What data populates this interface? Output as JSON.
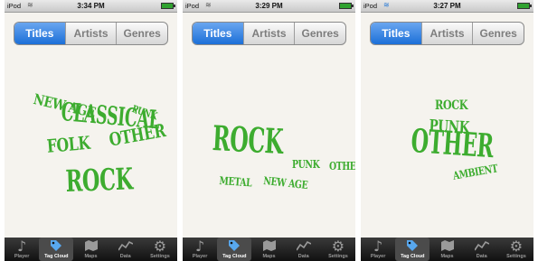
{
  "screens": [
    {
      "status": {
        "carrier": "iPod",
        "time": "3:34 PM",
        "wifi": "gray"
      },
      "segments": [
        "Titles",
        "Artists",
        "Genres"
      ],
      "active_segment": "Titles",
      "words": [
        "NEW AGE",
        "CLASSICAL",
        "PUNK",
        "FOLK",
        "OTHER",
        "ROCK"
      ]
    },
    {
      "status": {
        "carrier": "iPod",
        "time": "3:29 PM",
        "wifi": "gray"
      },
      "segments": [
        "Titles",
        "Artists",
        "Genres"
      ],
      "active_segment": "Titles",
      "words": [
        "ROCK",
        "PUNK",
        "OTHER",
        "METAL",
        "NEW AGE"
      ]
    },
    {
      "status": {
        "carrier": "iPod",
        "time": "3:27 PM",
        "wifi": "blue"
      },
      "segments": [
        "Titles",
        "Artists",
        "Genres"
      ],
      "active_segment": "Titles",
      "words": [
        "ROCK",
        "PUNK",
        "OTHER",
        "AMBIENT"
      ]
    }
  ],
  "tabbar": {
    "items": [
      {
        "label": "Player",
        "icon": "music-note-icon"
      },
      {
        "label": "Tag Cloud",
        "icon": "tag-icon"
      },
      {
        "label": "Maps",
        "icon": "map-icon"
      },
      {
        "label": "Data",
        "icon": "chart-icon"
      },
      {
        "label": "Settings",
        "icon": "gears-icon"
      }
    ],
    "active": "Tag Cloud"
  },
  "colors": {
    "tag_text": "#3dac2f",
    "segment_active": "#1b6fd8",
    "tabbar_bg": "#111111",
    "tab_active_icon": "#58a8ef"
  }
}
